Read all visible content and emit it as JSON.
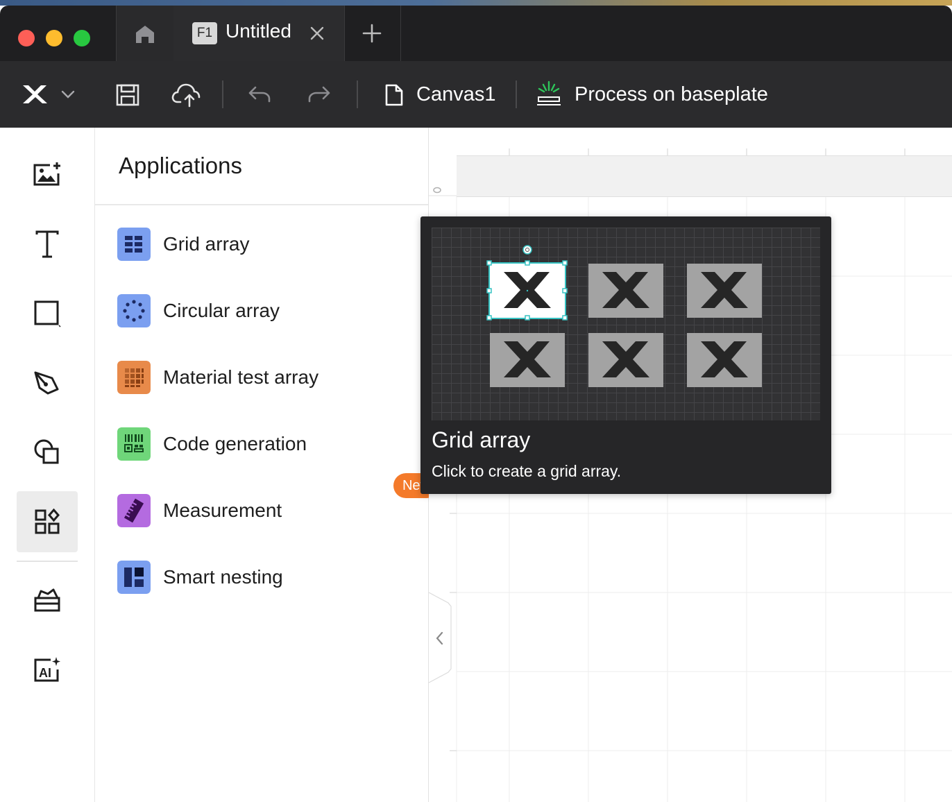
{
  "titlebar": {
    "tab_badge": "F1",
    "tab_title": "Untitled"
  },
  "toolbar": {
    "canvas_label": "Canvas1",
    "process_label": "Process on baseplate"
  },
  "left_toolbar": {
    "items": [
      "add-image-icon",
      "text-tool-icon",
      "rectangle-tool-icon",
      "pen-tool-icon",
      "shapes-icon",
      "applications-icon",
      "material-library-icon",
      "ai-tools-icon"
    ],
    "active": "applications-icon"
  },
  "panel": {
    "title": "Applications",
    "items": [
      {
        "label": "Grid array",
        "icon": "grid-array-icon",
        "color": "#7b9ff0"
      },
      {
        "label": "Circular array",
        "icon": "circular-array-icon",
        "color": "#7b9ff0"
      },
      {
        "label": "Material test array",
        "icon": "material-test-array-icon",
        "color": "#e88a4a"
      },
      {
        "label": "Code generation",
        "icon": "code-generation-icon",
        "color": "#6fd67a"
      },
      {
        "label": "Measurement",
        "icon": "measurement-icon",
        "color": "#b46be0",
        "badge": "New"
      },
      {
        "label": "Smart nesting",
        "icon": "smart-nesting-icon",
        "color": "#7b9ff0"
      }
    ]
  },
  "tooltip": {
    "title": "Grid array",
    "description": "Click to create a grid array."
  },
  "colors": {
    "titlebar_bg": "#1f1f21",
    "toolbar_bg": "#2b2b2d",
    "badge_orange": "#f47a2a",
    "selection_cyan": "#36c2c2"
  }
}
